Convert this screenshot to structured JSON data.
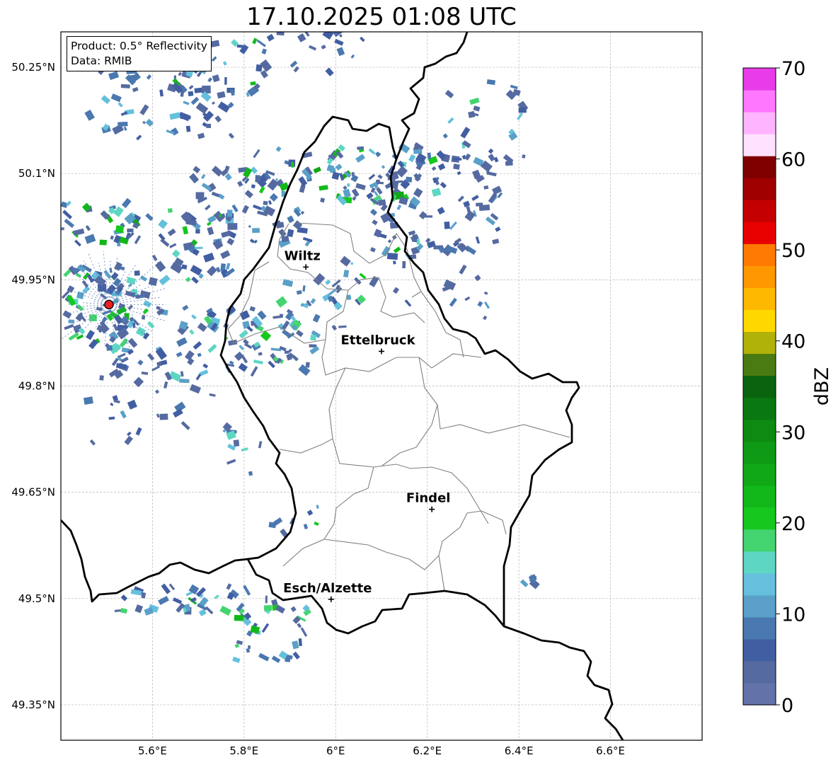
{
  "title": "17.10.2025 01:08 UTC",
  "info": {
    "product": "Product: 0.5° Reflectivity",
    "data_source": "Data: RMIB"
  },
  "map": {
    "extent": {
      "lon_min": 5.4,
      "lon_max": 6.8,
      "lat_min": 49.3,
      "lat_max": 50.3
    },
    "lon_ticks": [
      {
        "value": 5.6,
        "label": "5.6°E"
      },
      {
        "value": 5.8,
        "label": "5.8°E"
      },
      {
        "value": 6.0,
        "label": "6°E"
      },
      {
        "value": 6.2,
        "label": "6.2°E"
      },
      {
        "value": 6.4,
        "label": "6.4°E"
      },
      {
        "value": 6.6,
        "label": "6.6°E"
      }
    ],
    "lat_ticks": [
      {
        "value": 50.25,
        "label": "50.25°N"
      },
      {
        "value": 50.1,
        "label": "50.1°N"
      },
      {
        "value": 49.95,
        "label": "49.95°N"
      },
      {
        "value": 49.8,
        "label": "49.8°N"
      },
      {
        "value": 49.65,
        "label": "49.65°N"
      },
      {
        "value": 49.5,
        "label": "49.5°N"
      },
      {
        "value": 49.35,
        "label": "49.35°N"
      }
    ],
    "grid": true,
    "cities": [
      {
        "name": "Wiltz",
        "lon": 5.935,
        "lat": 49.968
      },
      {
        "name": "Ettelbruck",
        "lon": 6.1,
        "lat": 49.849
      },
      {
        "name": "Findel",
        "lon": 6.21,
        "lat": 49.626
      },
      {
        "name": "Esch/Alzette",
        "lon": 5.99,
        "lat": 49.499
      }
    ],
    "radar_site": {
      "lon": 5.505,
      "lat": 49.915,
      "color": "#e8211f"
    },
    "border_color": "#000000",
    "canton_color": "#808080"
  },
  "colorbar": {
    "label": "dBZ",
    "min": 0,
    "max": 70,
    "ticks": [
      0,
      10,
      20,
      30,
      40,
      50,
      60,
      70
    ],
    "colors": [
      "#6372a8",
      "#556aa0",
      "#425ea2",
      "#4a78b0",
      "#5aa0c8",
      "#64c0dc",
      "#5ed6c4",
      "#44d470",
      "#16c81e",
      "#12b81a",
      "#10a816",
      "#0e9a14",
      "#0d8a12",
      "#0a7810",
      "#0a640e",
      "#4a7a12",
      "#b0b20a",
      "#ffd800",
      "#ffb800",
      "#ff9800",
      "#ff7a00",
      "#e80000",
      "#c40000",
      "#a00000",
      "#800000",
      "#ffe2ff",
      "#ffb4ff",
      "#ff78ff",
      "#e83ce8"
    ]
  },
  "reflectivity_patches": [
    {
      "lon": 5.62,
      "lat": 50.2,
      "w": 0.16,
      "h": 0.05,
      "n": 60,
      "dbz": [
        3,
        14
      ]
    },
    {
      "lon": 5.74,
      "lat": 50.25,
      "w": 0.1,
      "h": 0.04,
      "n": 25,
      "dbz": [
        3,
        26
      ]
    },
    {
      "lon": 5.82,
      "lat": 50.06,
      "w": 0.14,
      "h": 0.06,
      "n": 60,
      "dbz": [
        3,
        12
      ]
    },
    {
      "lon": 5.98,
      "lat": 50.09,
      "w": 0.18,
      "h": 0.05,
      "n": 55,
      "dbz": [
        3,
        26
      ]
    },
    {
      "lon": 6.1,
      "lat": 50.1,
      "w": 0.12,
      "h": 0.04,
      "n": 35,
      "dbz": [
        3,
        22
      ]
    },
    {
      "lon": 6.22,
      "lat": 50.06,
      "w": 0.14,
      "h": 0.07,
      "n": 90,
      "dbz": [
        3,
        12
      ]
    },
    {
      "lon": 6.33,
      "lat": 50.17,
      "w": 0.1,
      "h": 0.06,
      "n": 25,
      "dbz": [
        3,
        20
      ]
    },
    {
      "lon": 5.95,
      "lat": 50.27,
      "w": 0.12,
      "h": 0.03,
      "n": 20,
      "dbz": [
        3,
        10
      ]
    },
    {
      "lon": 5.47,
      "lat": 50.03,
      "w": 0.1,
      "h": 0.03,
      "n": 35,
      "dbz": [
        3,
        26
      ]
    },
    {
      "lon": 5.65,
      "lat": 50.0,
      "w": 0.13,
      "h": 0.05,
      "n": 55,
      "dbz": [
        3,
        22
      ]
    },
    {
      "lon": 5.5,
      "lat": 49.91,
      "w": 0.09,
      "h": 0.06,
      "n": 90,
      "dbz": [
        3,
        24
      ]
    },
    {
      "lon": 5.62,
      "lat": 49.88,
      "w": 0.12,
      "h": 0.07,
      "n": 60,
      "dbz": [
        3,
        18
      ]
    },
    {
      "lon": 5.86,
      "lat": 49.87,
      "w": 0.1,
      "h": 0.05,
      "n": 60,
      "dbz": [
        3,
        20
      ]
    },
    {
      "lon": 5.95,
      "lat": 49.92,
      "w": 0.08,
      "h": 0.04,
      "n": 25,
      "dbz": [
        3,
        14
      ]
    },
    {
      "lon": 6.1,
      "lat": 49.96,
      "w": 0.08,
      "h": 0.05,
      "n": 18,
      "dbz": [
        3,
        22
      ]
    },
    {
      "lon": 5.6,
      "lat": 49.78,
      "w": 0.14,
      "h": 0.06,
      "n": 30,
      "dbz": [
        3,
        12
      ]
    },
    {
      "lon": 5.78,
      "lat": 49.71,
      "w": 0.06,
      "h": 0.04,
      "n": 10,
      "dbz": [
        3,
        16
      ]
    },
    {
      "lon": 5.62,
      "lat": 49.5,
      "w": 0.1,
      "h": 0.02,
      "n": 22,
      "dbz": [
        3,
        18
      ]
    },
    {
      "lon": 5.78,
      "lat": 49.5,
      "w": 0.1,
      "h": 0.02,
      "n": 14,
      "dbz": [
        3,
        24
      ]
    },
    {
      "lon": 5.86,
      "lat": 49.45,
      "w": 0.08,
      "h": 0.04,
      "n": 35,
      "dbz": [
        3,
        24
      ]
    },
    {
      "lon": 5.92,
      "lat": 49.62,
      "w": 0.06,
      "h": 0.03,
      "n": 8,
      "dbz": [
        3,
        22
      ]
    },
    {
      "lon": 6.43,
      "lat": 49.52,
      "w": 0.02,
      "h": 0.02,
      "n": 4,
      "dbz": [
        3,
        12
      ]
    },
    {
      "lon": 6.29,
      "lat": 49.93,
      "w": 0.05,
      "h": 0.04,
      "n": 10,
      "dbz": [
        3,
        14
      ]
    }
  ]
}
